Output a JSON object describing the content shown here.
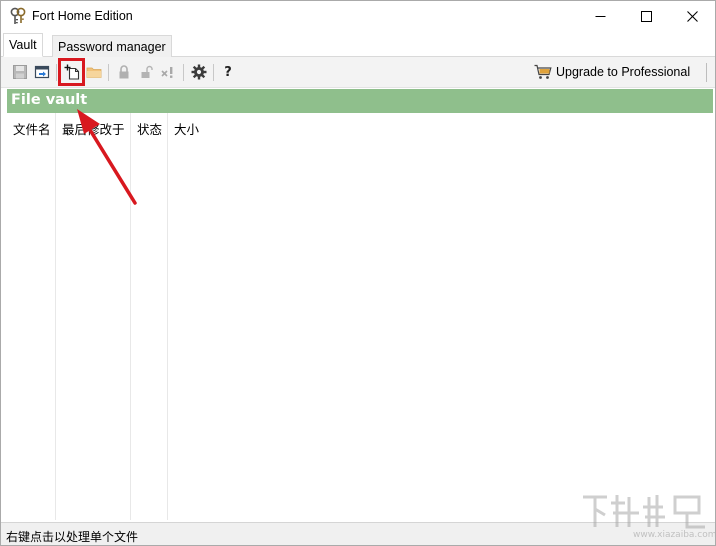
{
  "window": {
    "title": "Fort Home Edition",
    "app_icon": "key-icon",
    "controls": {
      "minimize": "minimize-icon",
      "maximize": "maximize-icon",
      "close": "close-icon"
    }
  },
  "tabs": [
    {
      "label": "Vault",
      "active": true
    },
    {
      "label": "Password manager",
      "active": false
    }
  ],
  "toolbar": {
    "buttons": [
      {
        "icon": "save-icon",
        "enabled": false
      },
      {
        "icon": "open-vault-icon",
        "enabled": true
      },
      {
        "icon": "new-vault-icon",
        "enabled": true,
        "highlighted": true
      },
      {
        "icon": "folder-icon",
        "enabled": false
      },
      {
        "icon": "lock-icon",
        "enabled": false
      },
      {
        "icon": "unlock-icon",
        "enabled": false
      },
      {
        "icon": "remove-icon",
        "enabled": false
      },
      {
        "icon": "gear-icon",
        "enabled": true
      },
      {
        "icon": "help-icon",
        "enabled": true,
        "label": "?"
      }
    ],
    "upgrade": {
      "icon": "cart-icon",
      "label": "Upgrade to Professional"
    }
  },
  "vault": {
    "title": "File vault",
    "header_color": "#8fbf8c",
    "columns": [
      "文件名",
      "最后修改于",
      "状态",
      "大小"
    ],
    "rows": []
  },
  "status_bar": {
    "text": "右键点击以处理单个文件"
  },
  "annotation": {
    "highlight_color": "#d8181f",
    "arrow_color": "#d8181f"
  },
  "watermark": {
    "text": "www.xiazaiba.com"
  }
}
